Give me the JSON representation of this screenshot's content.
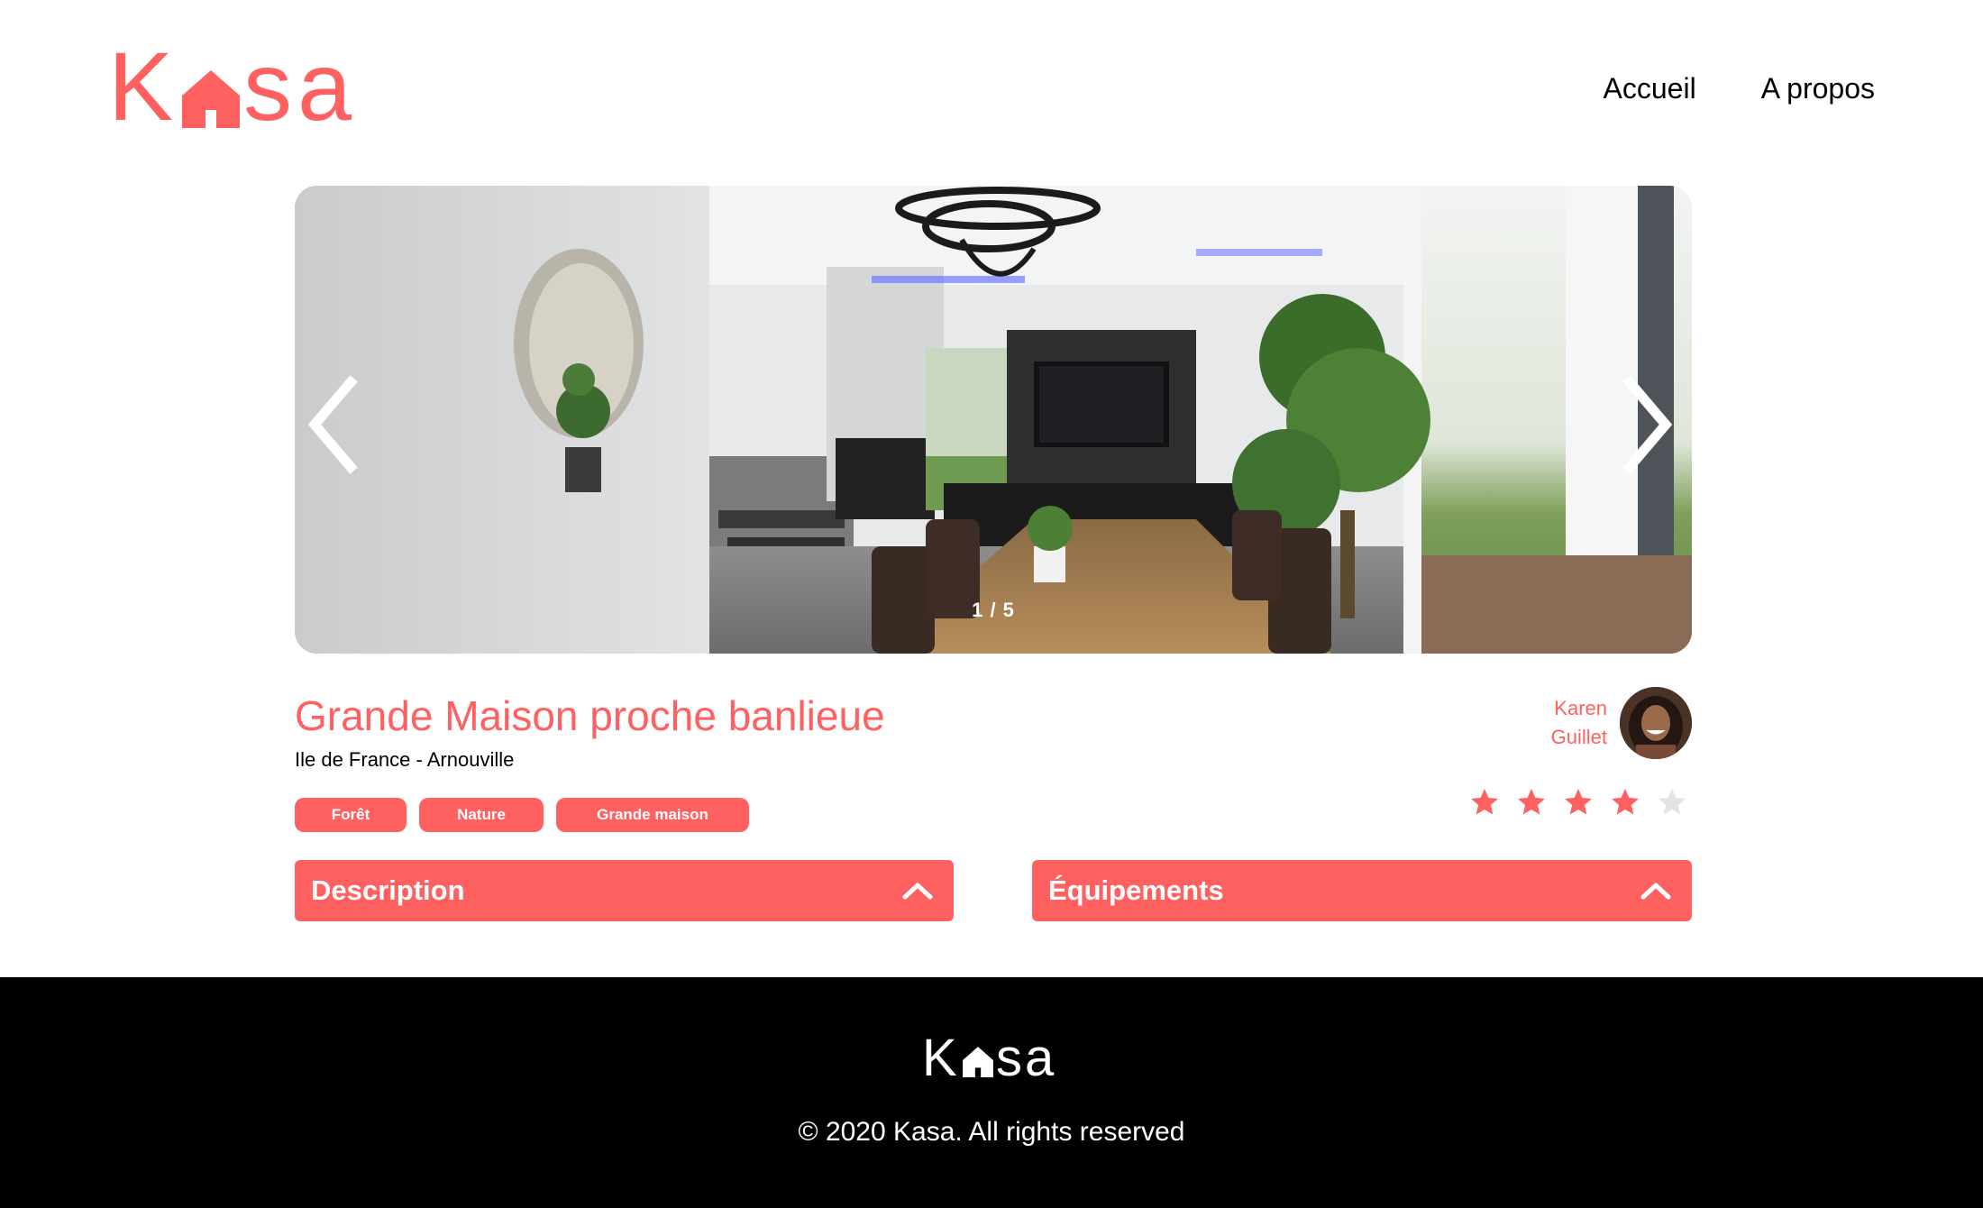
{
  "header": {
    "logo": {
      "part1": "K",
      "part2": "sa"
    },
    "nav": [
      {
        "label": "Accueil"
      },
      {
        "label": "A propos"
      }
    ]
  },
  "carousel": {
    "counter": "1 / 5",
    "current": 1,
    "total": 5,
    "prev_icon": "chevron-left-icon",
    "next_icon": "chevron-right-icon"
  },
  "listing": {
    "title": "Grande Maison proche banlieue",
    "location": "Ile de France - Arnouville",
    "tags": [
      {
        "label": "Forêt"
      },
      {
        "label": "Nature"
      },
      {
        "label": "Grande maison"
      }
    ],
    "host": {
      "first_name": "Karen",
      "last_name": "Guillet"
    },
    "rating": 4,
    "rating_max": 5
  },
  "collapses": [
    {
      "title": "Description",
      "icon": "chevron-up-icon"
    },
    {
      "title": "Équipements",
      "icon": "chevron-up-icon"
    }
  ],
  "footer": {
    "logo": {
      "part1": "K",
      "part2": "sa"
    },
    "copyright": "© 2020 Kasa. All rights reserved"
  },
  "colors": {
    "accent": "#FF6060",
    "star_off": "#E3E3E3",
    "footer_bg": "#000000"
  }
}
